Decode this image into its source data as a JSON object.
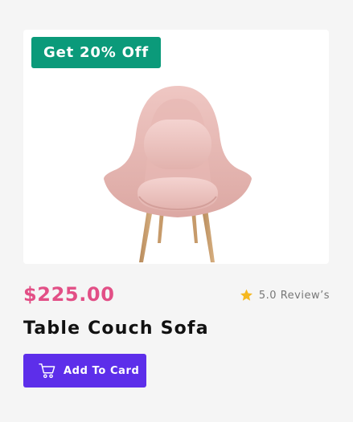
{
  "badge": {
    "text": "Get 20% Off"
  },
  "product": {
    "price": "$225.00",
    "name": "Table Couch Sofa",
    "rating_text": "5.0 Review’s",
    "image_icon": "armchair-image"
  },
  "actions": {
    "add_label": "Add To Card",
    "add_icon": "cart-icon"
  },
  "colors": {
    "badge": "#0b9a7a",
    "price": "#e24f86",
    "button": "#5d2eea",
    "star": "#f5b820"
  }
}
